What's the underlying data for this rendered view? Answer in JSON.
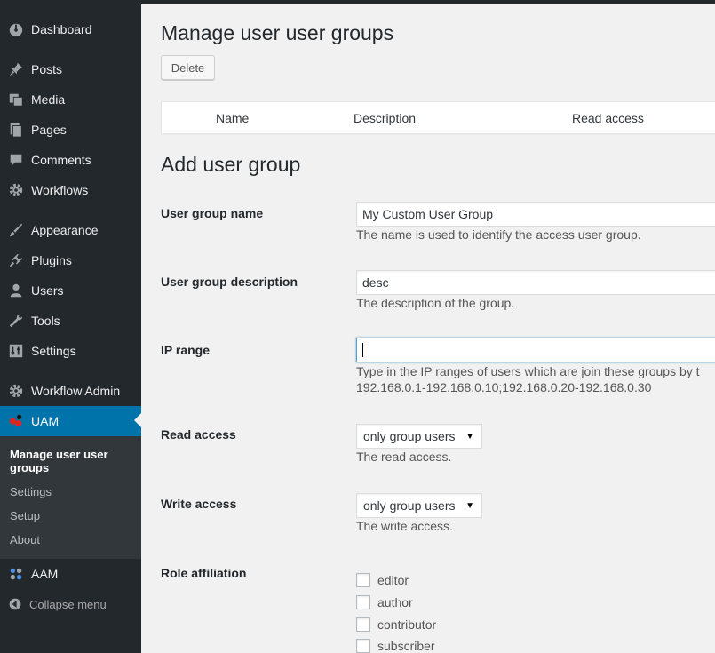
{
  "sidebar": {
    "items": [
      {
        "name": "dashboard",
        "label": "Dashboard",
        "icon": "dashboard-icon"
      },
      {
        "name": "posts",
        "label": "Posts",
        "icon": "pin-icon"
      },
      {
        "name": "media",
        "label": "Media",
        "icon": "media-icon"
      },
      {
        "name": "pages",
        "label": "Pages",
        "icon": "pages-icon"
      },
      {
        "name": "comments",
        "label": "Comments",
        "icon": "comment-icon"
      },
      {
        "name": "workflows",
        "label": "Workflows",
        "icon": "gear-icon"
      },
      {
        "name": "appearance",
        "label": "Appearance",
        "icon": "brush-icon"
      },
      {
        "name": "plugins",
        "label": "Plugins",
        "icon": "plug-icon"
      },
      {
        "name": "users",
        "label": "Users",
        "icon": "user-icon"
      },
      {
        "name": "tools",
        "label": "Tools",
        "icon": "wrench-icon"
      },
      {
        "name": "settings",
        "label": "Settings",
        "icon": "settings-icon"
      },
      {
        "name": "workflow-admin",
        "label": "Workflow Admin",
        "icon": "gear-icon"
      },
      {
        "name": "uam",
        "label": "UAM",
        "icon": "uam-icon"
      },
      {
        "name": "aam",
        "label": "AAM",
        "icon": "aam-icon"
      }
    ],
    "submenu": [
      {
        "label": "Manage user user groups"
      },
      {
        "label": "Settings"
      },
      {
        "label": "Setup"
      },
      {
        "label": "About"
      }
    ],
    "collapse_label": "Collapse menu",
    "active_color": "#0073aa"
  },
  "page": {
    "title": "Manage user user groups",
    "delete_label": "Delete",
    "table_headers": [
      "Name",
      "Description",
      "Read access"
    ],
    "add_title": "Add user group"
  },
  "form": {
    "group_name": {
      "label": "User group name",
      "value": "My Custom User Group",
      "help": "The name is used to identify the access user group."
    },
    "group_description": {
      "label": "User group description",
      "value": "desc",
      "help": "The description of the group."
    },
    "ip_range": {
      "label": "IP range",
      "value": "",
      "help_line1": "Type in the IP ranges of users which are join these groups by t",
      "help_line2": "192.168.0.1-192.168.0.10;192.168.0.20-192.168.0.30"
    },
    "read_access": {
      "label": "Read access",
      "selected": "only group users",
      "help": "The read access."
    },
    "write_access": {
      "label": "Write access",
      "selected": "only group users",
      "help": "The write access."
    },
    "role_affiliation": {
      "label": "Role affiliation",
      "roles": [
        "editor",
        "author",
        "contributor",
        "subscriber"
      ]
    }
  }
}
